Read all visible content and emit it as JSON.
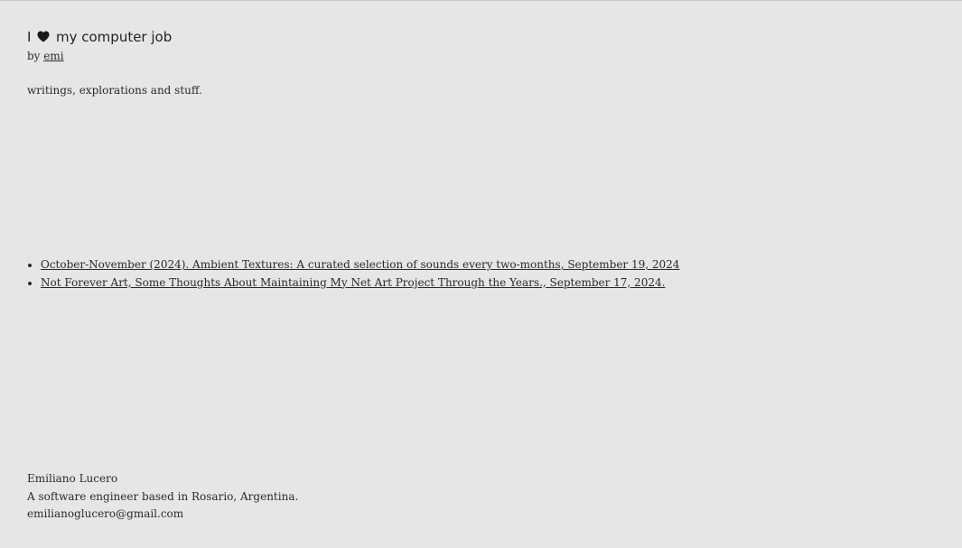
{
  "header": {
    "title_before": "I",
    "title_icon": "black-heart-icon",
    "title_after": "my computer job",
    "byline_prefix": "by",
    "author_link": "emi",
    "tagline": "writings, explorations and stuff."
  },
  "posts": [
    {
      "link": "October-November (2024). Ambient Textures: A curated selection of sounds every two-months, September 19, 2024"
    },
    {
      "link": "Not Forever Art, Some Thoughts About Maintaining My Net Art Project Through the Years., September 17, 2024."
    }
  ],
  "footer": {
    "name": "Emiliano Lucero",
    "bio": "A software engineer based in Rosario, Argentina.",
    "email": "emilianoglucero@gmail.com"
  },
  "colors": {
    "background": "#e6e6e6",
    "text": "#2a2a2a",
    "heart": "#1a1a1a"
  }
}
